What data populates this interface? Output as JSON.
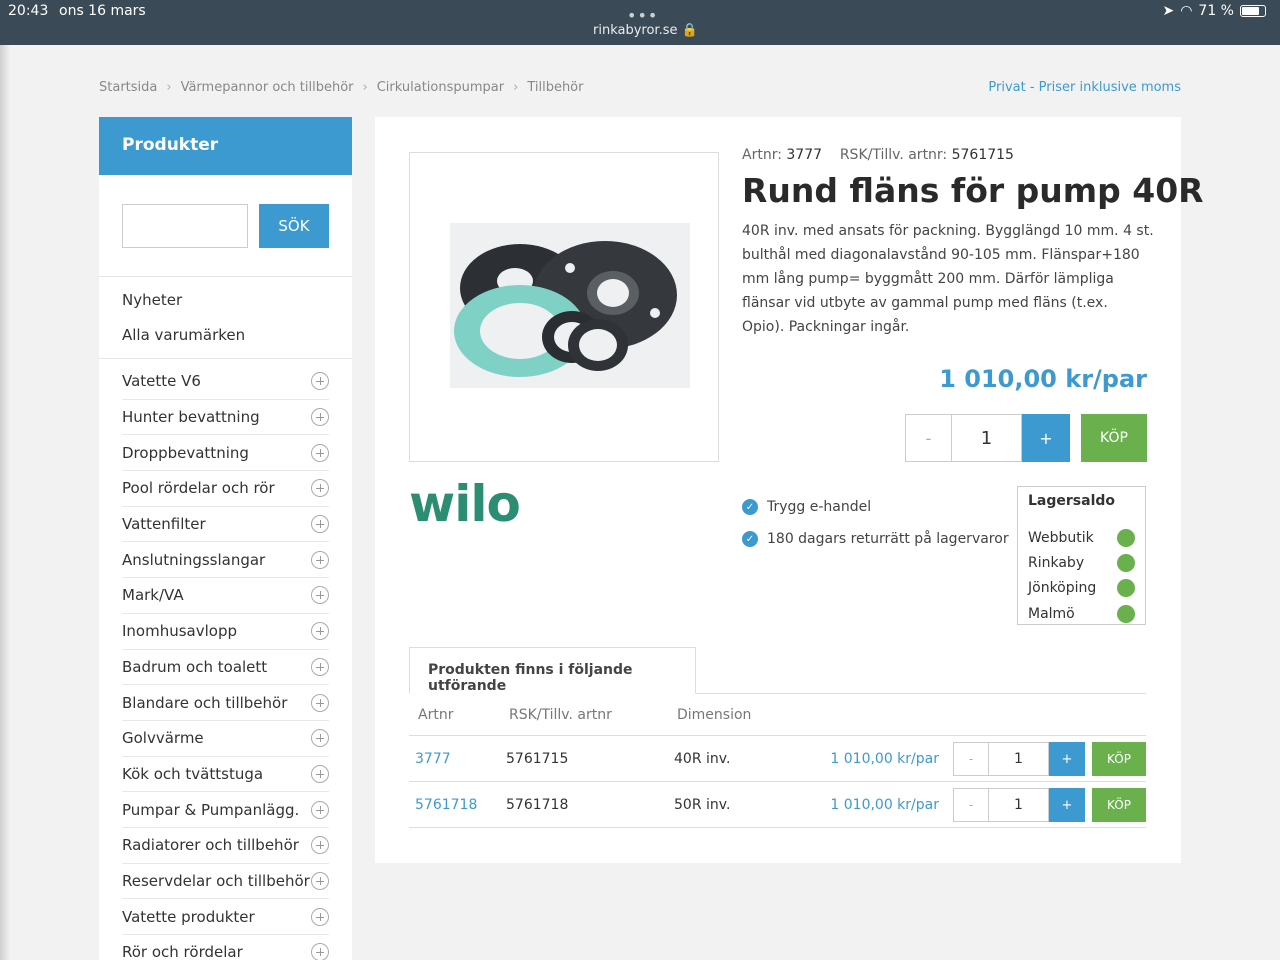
{
  "statusbar": {
    "time": "20:43",
    "date": "ons 16 mars",
    "url": "rinkabyror.se",
    "battery": "71 %"
  },
  "breadcrumb": [
    "Startsida",
    "Värmepannor och tillbehör",
    "Cirkulationspumpar",
    "Tillbehör"
  ],
  "price_mode": "Privat - Priser inklusive moms",
  "sidebar": {
    "title": "Produkter",
    "search_button": "SÖK",
    "search_value": "",
    "quick_links": [
      "Nyheter",
      "Alla varumärken"
    ],
    "categories": [
      "Vatette V6",
      "Hunter bevattning",
      "Droppbevattning",
      "Pool rördelar och rör",
      "Vattenfilter",
      "Anslutningsslangar",
      "Mark/VA",
      "Inomhusavlopp",
      "Badrum och toalett",
      "Blandare och tillbehör",
      "Golvvärme",
      "Kök och tvättstuga",
      "Pumpar & Pumpanlägg.",
      "Radiatorer och tillbehör",
      "Reservdelar och tillbehör",
      "Vatette produkter",
      "Rör och rördelar"
    ]
  },
  "product": {
    "artnr_label": "Artnr:",
    "artnr": "3777",
    "rsk_label": "RSK/Tillv. artnr:",
    "rsk": "5761715",
    "title": "Rund fläns för pump 40R",
    "description": "40R inv. med ansats för packning. Bygglängd 10 mm. 4 st. bulthål med diagonalavstånd 90-105 mm. Flänspar+180 mm lång pump= byggmått 200 mm. Därför lämpliga flänsar vid utbyte av gammal pump med fläns (t.ex. Opio). Packningar ingår.",
    "price": "1 010,00 kr/par",
    "qty": "1",
    "minus": "-",
    "plus": "+",
    "buy": "KÖP",
    "brand": "wilo"
  },
  "trust": [
    "Trygg e-handel",
    "180 dagars returrätt på lagervaror"
  ],
  "stock": {
    "title": "Lagersaldo",
    "locations": [
      "Webbutik",
      "Rinkaby",
      "Jönköping",
      "Malmö"
    ],
    "status_color": "#6ab04c"
  },
  "variants": {
    "tab_label": "Produkten finns i följande utförande",
    "headers": [
      "Artnr",
      "RSK/Tillv. artnr",
      "Dimension"
    ],
    "rows": [
      {
        "artnr": "3777",
        "rsk": "5761715",
        "dimension": "40R inv.",
        "price": "1 010,00 kr/par",
        "qty": "1"
      },
      {
        "artnr": "5761718",
        "rsk": "5761718",
        "dimension": "50R inv.",
        "price": "1 010,00 kr/par",
        "qty": "1"
      }
    ]
  },
  "colors": {
    "accent": "#3d9ad1",
    "buy": "#6ab04c",
    "brand": "#2b8e72"
  }
}
